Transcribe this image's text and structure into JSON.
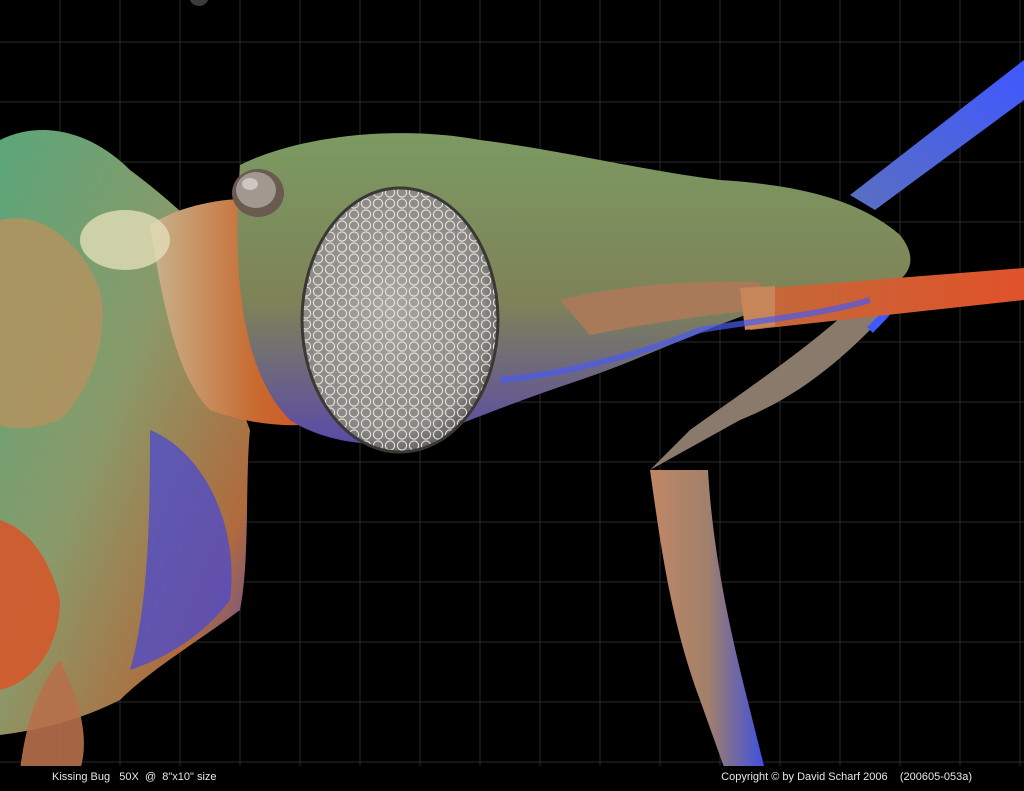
{
  "image": {
    "subject": "kissing-bug-sem-micrograph",
    "background_color": "#000000",
    "grid_color": "#2a2a2a"
  },
  "caption": {
    "left": "Kissing Bug   50X  @  8\"x10\" size",
    "right": "Copyright © by David Scharf 2006    (200605-053a)"
  },
  "colors": {
    "body_green": "#6f9a6a",
    "body_orange": "#d9552a",
    "body_blue": "#3b4fd8",
    "eye_gray": "#9b9b97",
    "tan": "#b89872"
  }
}
